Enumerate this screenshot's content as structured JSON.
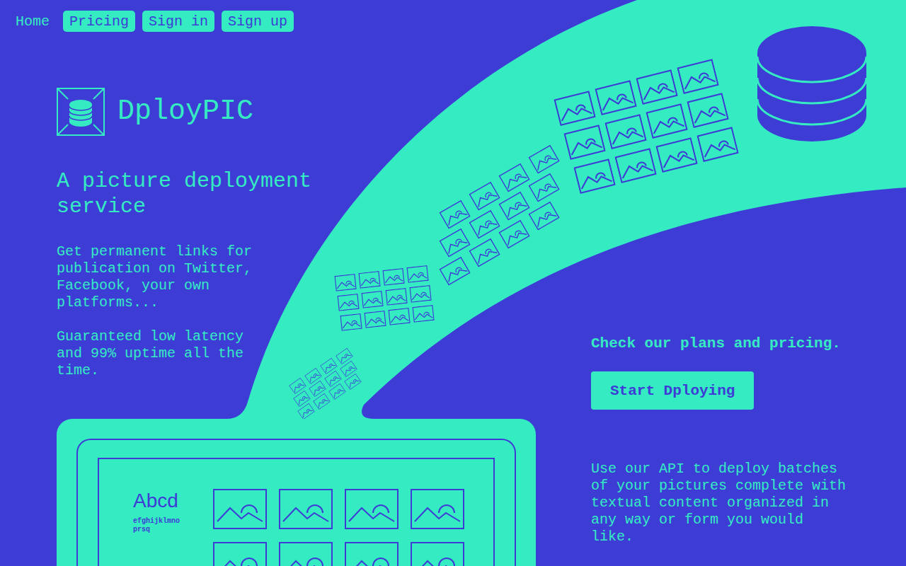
{
  "nav": [
    {
      "label": "Home",
      "kind": "link"
    },
    {
      "label": "Pricing",
      "kind": "button"
    },
    {
      "label": "Sign in",
      "kind": "button"
    },
    {
      "label": "Sign up",
      "kind": "button"
    }
  ],
  "brand": {
    "name": "DployPIC"
  },
  "hero": {
    "title": "A picture deployment service",
    "paragraphs": [
      "Get permanent links for publication on Twitter, Facebook, your own platforms...",
      "Guaranteed low latency and 99% uptime all the time."
    ]
  },
  "cta": {
    "heading": "Check our plans and pricing.",
    "button": "Start Dploying",
    "description": "Use our API to deploy batches of your pictures complete with textual content organized in any way or form you would like."
  },
  "screen": {
    "headline": "Abcd",
    "caption": "efghijklmno prsq"
  }
}
